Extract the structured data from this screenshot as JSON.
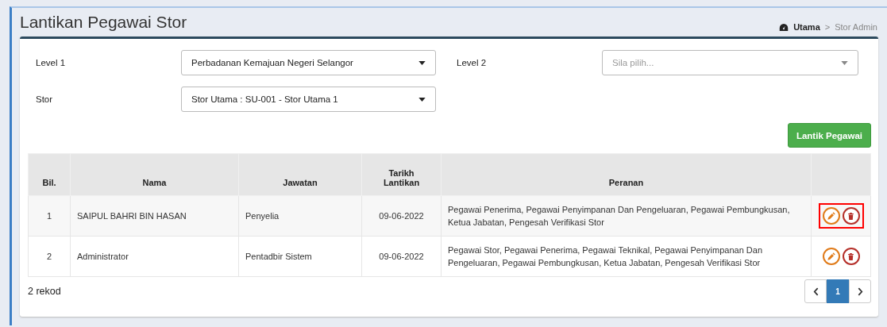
{
  "page": {
    "title": "Lantikan Pegawai Stor"
  },
  "breadcrumb_separator": ">",
  "breadcrumb": [
    {
      "label": "Utama",
      "kind": "home"
    },
    {
      "label": "Stor Admin",
      "kind": "current"
    }
  ],
  "filters": [
    {
      "label": "Level 1",
      "value": "Perbadanan Kemajuan Negeri Selangor"
    },
    {
      "label": "Level 2",
      "placeholder": "Sila pilih..."
    },
    {
      "label": "Stor",
      "value": "Stor Utama : SU-001 - Stor Utama 1"
    }
  ],
  "add_button": "Lantik Pegawai",
  "table": {
    "columns": [
      "Bil.",
      "Nama",
      "Jawatan",
      "Tarikh Lantikan",
      "Peranan"
    ],
    "rows": [
      {
        "cells": [
          "1",
          "SAIPUL BAHRI BIN HASAN",
          "Penyelia",
          "09-06-2022",
          "Pegawai Penerima, Pegawai Penyimpanan Dan Pengeluaran, Pegawai Pembungkusan, Ketua Jabatan, Pengesah Verifikasi Stor"
        ],
        "highlighted": true
      },
      {
        "cells": [
          "2",
          "Administrator",
          "Pentadbir Sistem",
          "09-06-2022",
          "Pegawai Stor, Pegawai Penerima, Pegawai Teknikal, Pegawai Penyimpanan Dan Pengeluaran, Pegawai Pembungkusan, Ketua Jabatan, Pengesah Verifikasi Stor"
        ],
        "highlighted": false
      }
    ]
  },
  "record_count": "2 rekod",
  "pagination": [
    {
      "label": "1",
      "selected": true
    }
  ]
}
